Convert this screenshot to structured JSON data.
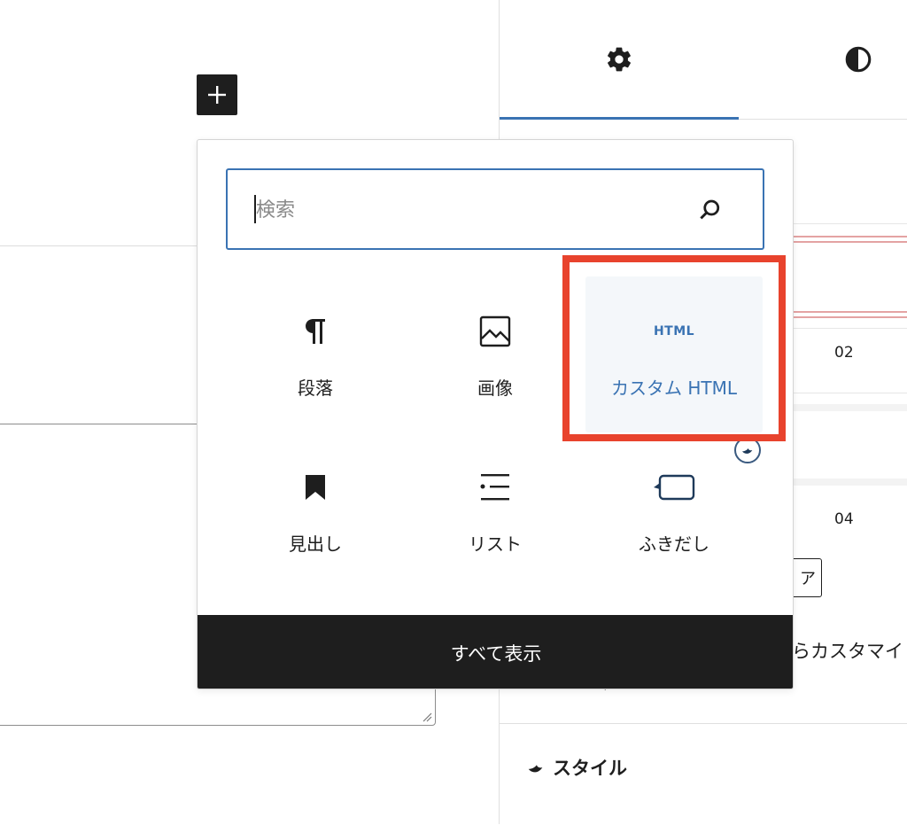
{
  "inserter_toggle": {
    "icon": "plus-icon"
  },
  "sidebar": {
    "tabs": [
      {
        "icon": "gear-icon",
        "active": true
      },
      {
        "icon": "contrast-icon",
        "active": false
      }
    ],
    "numbers": [
      "02",
      "04"
    ],
    "clear_button_label": "ア",
    "customize_text": "らカスタマイ",
    "style_panel_title": "スタイル"
  },
  "inserter": {
    "search": {
      "placeholder": "検索",
      "value": ""
    },
    "blocks": [
      {
        "label": "段落",
        "icon": "pilcrow-icon"
      },
      {
        "label": "画像",
        "icon": "image-icon"
      },
      {
        "label": "カスタム HTML",
        "icon": "html-icon",
        "icon_text": "HTML",
        "highlighted": true
      },
      {
        "label": "見出し",
        "icon": "bookmark-icon"
      },
      {
        "label": "リスト",
        "icon": "list-icon"
      },
      {
        "label": "ふきだし",
        "icon": "speech-bubble-icon"
      }
    ],
    "show_all_label": "すべて表示"
  },
  "colors": {
    "accent": "#3a73b3",
    "highlight_frame": "#e8432d",
    "dark": "#1e1e1e"
  }
}
